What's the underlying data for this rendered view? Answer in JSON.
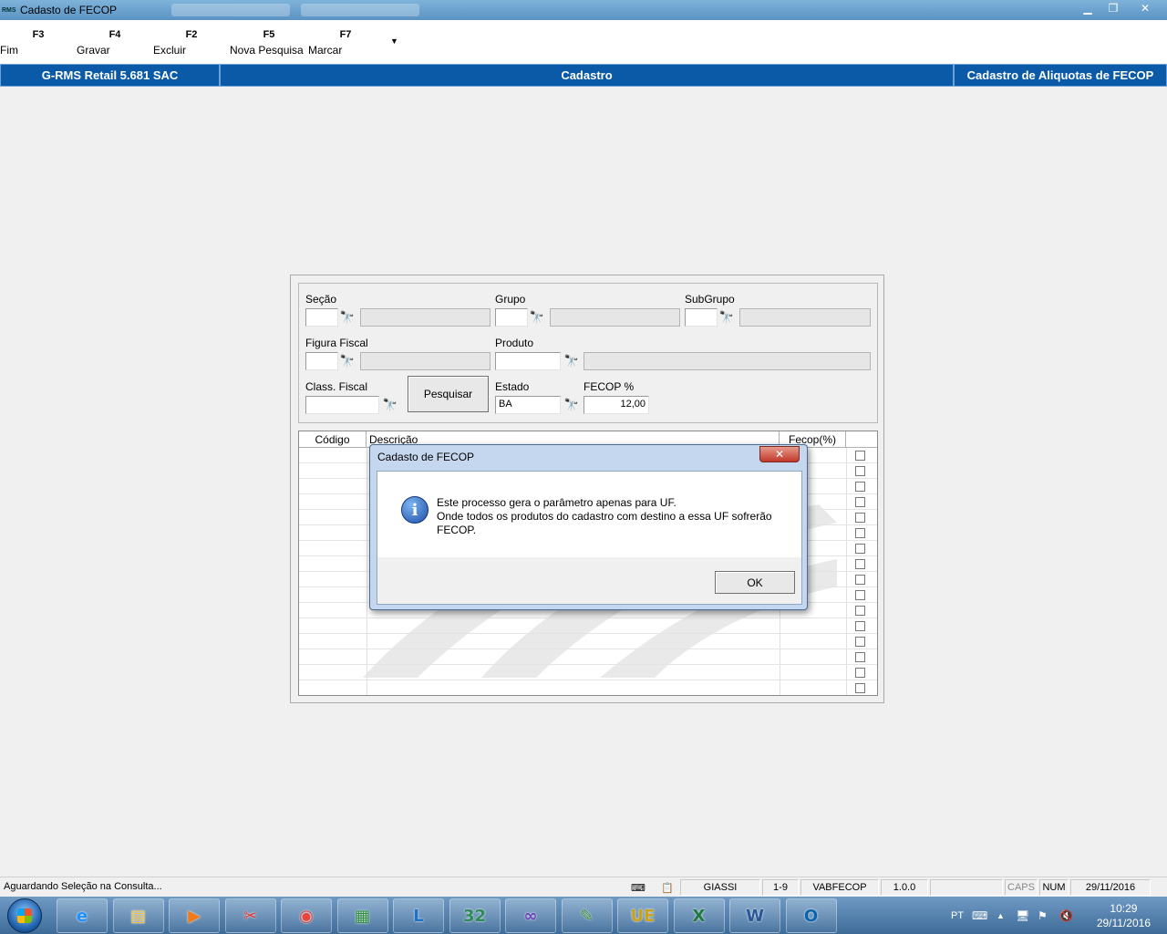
{
  "window": {
    "app_icon": "RMS",
    "title": "Cadasto de FECOP"
  },
  "toolbar": {
    "buttons": [
      {
        "key": "F3",
        "label": "Fim"
      },
      {
        "key": "F4",
        "label": "Gravar"
      },
      {
        "key": "F2",
        "label": "Excluir"
      },
      {
        "key": "F5",
        "label": "Nova Pesquisa"
      },
      {
        "key": "F7",
        "label": "Marcar"
      }
    ]
  },
  "header": {
    "app_version": "G-RMS Retail 5.681 SAC",
    "section": "Cadastro",
    "screen": "Cadastro de Aliquotas de FECOP"
  },
  "filters": {
    "secao_label": "Seção",
    "grupo_label": "Grupo",
    "subgrupo_label": "SubGrupo",
    "figura_fiscal_label": "Figura Fiscal",
    "produto_label": "Produto",
    "class_fiscal_label": "Class. Fiscal",
    "pesquisar_label": "Pesquisar",
    "estado_label": "Estado",
    "estado_value": "BA",
    "fecop_label": "FECOP %",
    "fecop_value": "12,00"
  },
  "grid": {
    "columns": [
      "Código",
      "Descrição",
      "Fecop(%)"
    ],
    "row_count": 16
  },
  "dialog": {
    "title": "Cadasto de FECOP",
    "line1": "Este processo gera o parâmetro apenas para UF.",
    "line2": "Onde todos os produtos do cadastro com destino a essa UF sofrerão",
    "line3": "FECOP.",
    "ok_label": "OK"
  },
  "statusbar": {
    "message": "Aguardando Seleção na Consulta...",
    "user": "GIASSI",
    "range": "1-9",
    "program": "VABFECOP",
    "version": "1.0.0",
    "caps": "CAPS",
    "num": "NUM",
    "date": "29/11/2016"
  },
  "taskbar": {
    "lang": "PT",
    "time": "10:29",
    "date": "29/11/2016",
    "apps": [
      "internet-explorer-icon",
      "file-explorer-icon",
      "media-player-icon",
      "snipping-tool-icon",
      "chrome-icon",
      "rms-icon",
      "lync-icon",
      "calculator-icon",
      "visual-studio-icon",
      "project-icon",
      "ultraedit-icon",
      "excel-icon",
      "word-icon",
      "outlook-icon"
    ]
  }
}
